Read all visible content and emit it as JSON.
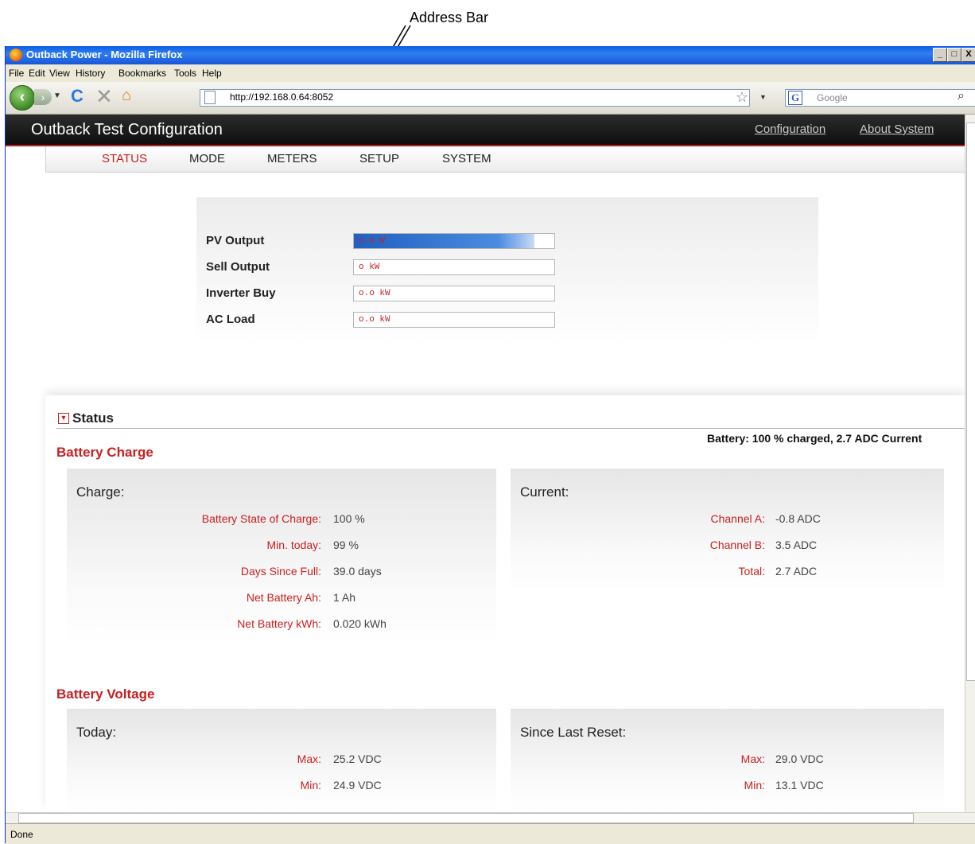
{
  "annotation": {
    "label": "Address Bar"
  },
  "window": {
    "title": "Outback Power - Mozilla Firefox",
    "controls": {
      "minimize": "_",
      "maximize": "□",
      "close": "X"
    }
  },
  "menubar": {
    "items": [
      {
        "label": "File"
      },
      {
        "label": "Edit"
      },
      {
        "label": "View"
      },
      {
        "label": "History"
      },
      {
        "label": "Bookmarks"
      },
      {
        "label": "Tools"
      },
      {
        "label": "Help"
      }
    ]
  },
  "toolbar": {
    "address": "http://192.168.0.64:8052",
    "search_placeholder": "Google",
    "icons": [
      "back-icon",
      "forward-icon",
      "reload-icon",
      "stop-icon",
      "home-icon",
      "page-icon",
      "bookmark-star-icon",
      "google-icon",
      "search-icon"
    ]
  },
  "site": {
    "title": "Outback Test Configuration",
    "header_links": {
      "configuration": "Configuration",
      "about": "About System"
    },
    "nav": {
      "status": "STATUS",
      "mode": "MODE",
      "meters": "METERS",
      "setup": "SETUP",
      "system": "SYSTEM"
    },
    "accent_color": "#c82020"
  },
  "power": {
    "rows": [
      {
        "label": "PV Output",
        "value": "o.o W",
        "fill_fraction": 0.9
      },
      {
        "label": "Sell Output",
        "value": "o kW"
      },
      {
        "label": "Inverter Buy",
        "value": "o.o kW"
      },
      {
        "label": "AC Load",
        "value": "o.o kW"
      }
    ]
  },
  "status": {
    "heading": "Status",
    "summary": "Battery: 100 % charged, 2.7 ADC Current",
    "battery_charge": {
      "heading": "Battery Charge",
      "charge": {
        "title": "Charge:",
        "rows": [
          {
            "label": "Battery State of Charge:",
            "value": "100 %"
          },
          {
            "label": "Min. today:",
            "value": "99 %"
          },
          {
            "label": "Days Since Full:",
            "value": "39.0 days"
          },
          {
            "label": "Net Battery Ah:",
            "value": "1 Ah"
          },
          {
            "label": "Net Battery kWh:",
            "value": "0.020 kWh"
          }
        ]
      },
      "current": {
        "title": "Current:",
        "rows": [
          {
            "label": "Channel A:",
            "value": "-0.8 ADC"
          },
          {
            "label": "Channel B:",
            "value": "3.5 ADC"
          },
          {
            "label": "Total:",
            "value": "2.7 ADC"
          }
        ]
      }
    },
    "battery_voltage": {
      "heading": "Battery Voltage",
      "today": {
        "title": "Today:",
        "rows": [
          {
            "label": "Max:",
            "value": "25.2 VDC"
          },
          {
            "label": "Min:",
            "value": "24.9 VDC"
          }
        ]
      },
      "since_reset": {
        "title": "Since Last Reset:",
        "rows": [
          {
            "label": "Max:",
            "value": "29.0 VDC"
          },
          {
            "label": "Min:",
            "value": "13.1 VDC"
          }
        ]
      }
    }
  },
  "statusbar": {
    "text": "Done"
  }
}
